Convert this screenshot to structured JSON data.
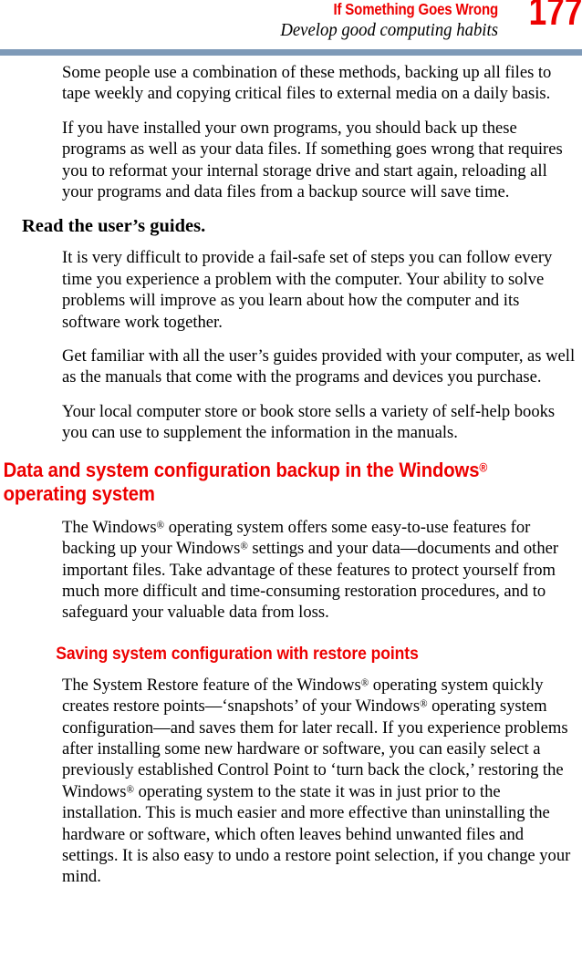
{
  "header": {
    "chapter_title": "If Something Goes Wrong",
    "section_title": "Develop good computing habits",
    "page_number": "177",
    "rule_color": "#7e9ab8",
    "accent_color": "#ed0000"
  },
  "content": {
    "para_1": "Some people use a combination of these methods, backing up all files to tape weekly and copying critical files to external media on a daily basis.",
    "para_2": "If you have installed your own programs, you should back up these programs as well as your data files. If something goes wrong that requires you to reformat your internal storage drive and start again, reloading all your programs and data files from a backup source will save time.",
    "heading_read_guides": "Read the user’s guides.",
    "para_3": "It is very difficult to provide a fail-safe set of steps you can follow every time you experience a problem with the computer. Your ability to solve problems will improve as you learn about how the computer and its software work together.",
    "para_4": "Get familiar with all the user’s guides provided with your computer, as well as the manuals that come with the programs and devices you purchase.",
    "para_5": "Your local computer store or book store sells a variety of self-help books you can use to supplement the information in the manuals.",
    "section_heading": {
      "part_1": "Data and system configuration backup in the Windows",
      "trademark": "®",
      "part_2": " operating system"
    },
    "para_6": {
      "seg_1": "The Windows",
      "tm_1": "®",
      "seg_2": " operating system offers some easy-to-use features for backing up your Windows",
      "tm_2": "®",
      "seg_3": " settings and your data—documents and other important files. Take advantage of these features to protect yourself from much more difficult and time-consuming restoration procedures, and to safeguard your valuable data from loss."
    },
    "sub_heading": "Saving system configuration with restore points",
    "para_7": {
      "seg_1": "The System Restore feature of the Windows",
      "tm_1": "®",
      "seg_2": " operating system quickly creates restore points—‘snapshots’ of your Windows",
      "tm_2": "®",
      "seg_3": " operating system configuration—and saves them for later recall. If you experience problems after installing some new hardware or software, you can easily select a previously established Control Point to ‘turn back the clock,’ restoring the Windows",
      "tm_3": "®",
      "seg_4": " operating system to the state it was in just prior to the installation. This is much easier and more effective than uninstalling the hardware or software, which often leaves behind unwanted files and settings. It is also easy to undo a restore point selection, if you change your mind."
    }
  }
}
